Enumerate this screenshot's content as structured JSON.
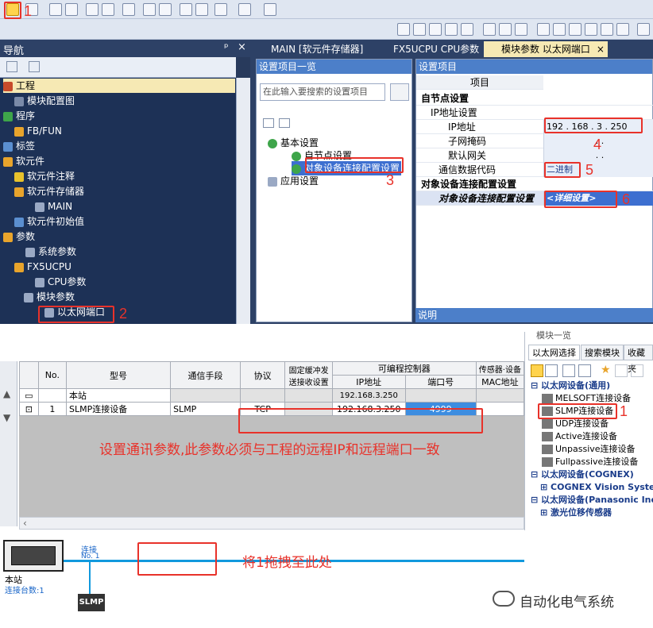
{
  "toolbar": {
    "step_label": "1"
  },
  "nav": {
    "title": "导航",
    "pin": "ᵖ",
    "close": "×",
    "tree": [
      {
        "label": "工程",
        "level": 0
      },
      {
        "label": "模块配置图",
        "level": 1
      },
      {
        "label": "程序",
        "level": 0
      },
      {
        "label": "FB/FUN",
        "level": 1
      },
      {
        "label": "标签",
        "level": 0
      },
      {
        "label": "软元件",
        "level": 0
      },
      {
        "label": "软元件注释",
        "level": 1
      },
      {
        "label": "软元件存储器",
        "level": 1
      },
      {
        "label": "MAIN",
        "level": 2
      },
      {
        "label": "软元件初始值",
        "level": 1
      },
      {
        "label": "参数",
        "level": 0
      },
      {
        "label": "系统参数",
        "level": 1
      },
      {
        "label": "FX5UCPU",
        "level": 1
      },
      {
        "label": "CPU参数",
        "level": 2
      },
      {
        "label": "模块参数",
        "level": 2
      },
      {
        "label": "以太网端口",
        "level": 3
      }
    ],
    "step_label": "2"
  },
  "tabs": [
    {
      "label": "MAIN [软元件存储器]"
    },
    {
      "label": "FX5UCPU CPU参数"
    },
    {
      "label": "模块参数 以太网端口"
    }
  ],
  "tab_close": "×",
  "settings_list": {
    "header": "设置项目一览",
    "search_placeholder": "在此输入要搜索的设置项目",
    "items": [
      {
        "label": "基本设置"
      },
      {
        "label": "自节点设置"
      },
      {
        "label": "对象设备连接配置设置"
      },
      {
        "label": "应用设置"
      }
    ],
    "step_label": "3"
  },
  "settings": {
    "header": "设置项目",
    "col_header": "项目",
    "rows": [
      {
        "label": "自节点设置",
        "value": ""
      },
      {
        "label": "IP地址设置",
        "value": ""
      },
      {
        "label": "IP地址",
        "value": "192 . 168 . 3 . 250"
      },
      {
        "label": "子网掩码",
        "value": ". ."
      },
      {
        "label": "默认网关",
        "value": ". ."
      },
      {
        "label": "通信数据代码",
        "value": "二进制"
      },
      {
        "label": "对象设备连接配置设置",
        "value": ""
      },
      {
        "label": "对象设备连接配置设置",
        "value": "<详细设置>"
      }
    ],
    "step4": "4",
    "step5": "5",
    "step6": "6",
    "description": "说明"
  },
  "table": {
    "headers": [
      "No.",
      "型号",
      "通信手段",
      "协议",
      "固定缓冲发送接收设置",
      "可编程控制器",
      "传感器·设备"
    ],
    "sub_headers": [
      "IP地址",
      "端口号",
      "MAC地址"
    ],
    "rows": [
      {
        "no": "",
        "model": "本站",
        "means": "",
        "protocol": "",
        "fixed": "",
        "ip": "192.168.3.250",
        "port": "",
        "mac": ""
      },
      {
        "no": "1",
        "model": "SLMP连接设备",
        "means": "SLMP",
        "protocol": "TCP",
        "fixed": "",
        "ip": "192.168.3.250",
        "port": "4999",
        "mac": ""
      }
    ],
    "annotation": "设置通讯参数,此参数必须与工程的远程IP和远程端口一致"
  },
  "network": {
    "station": "本站",
    "station_count": "连接台数:1",
    "link": "连接",
    "link_no": "No. 1",
    "slmp_badge": "SLMP",
    "drag_hint": "将1拖拽至此处"
  },
  "right_panel": {
    "title": "模块一览",
    "tabs": [
      "以太网选择",
      "搜索模块",
      "收藏夹"
    ],
    "groups": [
      {
        "label": "以太网设备(通用)",
        "items": [
          "MELSOFT连接设备",
          "SLMP连接设备",
          "UDP连接设备",
          "Active连接设备",
          "Unpassive连接设备",
          "Fullpassive连接设备"
        ]
      },
      {
        "label": "以太网设备(COGNEX)",
        "items": [
          "COGNEX Vision System"
        ]
      },
      {
        "label": "以太网设备(Panasonic Indu",
        "items": [
          "激光位移传感器"
        ]
      }
    ],
    "step_label": "1"
  },
  "watermark": "自动化电气系统",
  "colors": {
    "accent": "#e8322a",
    "header_blue": "#4c7fc9",
    "nav_dark": "#1d3156",
    "network": "#1199dd"
  }
}
